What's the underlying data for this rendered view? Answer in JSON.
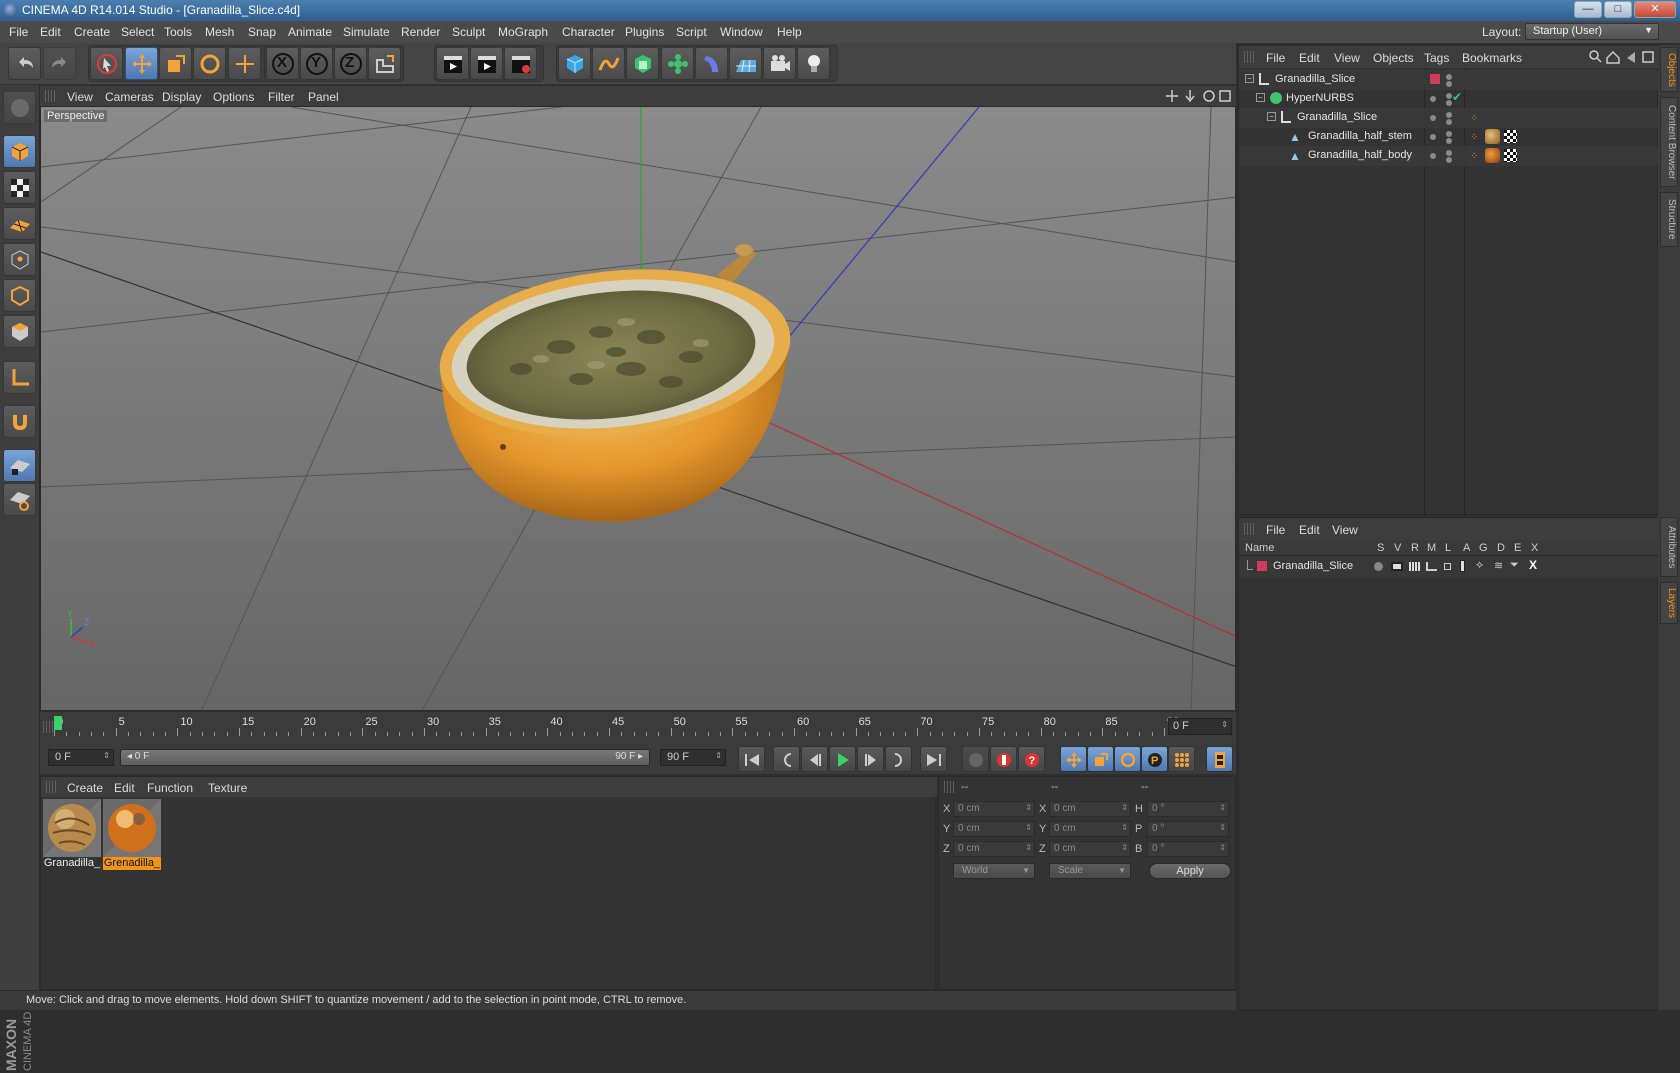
{
  "window": {
    "title": "CINEMA 4D R14.014 Studio - [Granadilla_Slice.c4d]",
    "min": "—",
    "max": "□",
    "close": "✕"
  },
  "menubar": {
    "items": [
      "File",
      "Edit",
      "Create",
      "Select",
      "Tools",
      "Mesh",
      "Snap",
      "Animate",
      "Simulate",
      "Render",
      "Sculpt",
      "MoGraph",
      "Character",
      "Plugins",
      "Script",
      "Window",
      "Help"
    ],
    "layout_label": "Layout:",
    "layout_value": "Startup (User)"
  },
  "toolbar": {
    "axis_x": "X",
    "axis_y": "Y",
    "axis_z": "Z"
  },
  "viewport": {
    "menu": [
      "View",
      "Cameras",
      "Display",
      "Options",
      "Filter",
      "Panel"
    ],
    "label": "Perspective",
    "axis_y": "Y",
    "axis_z": "Z",
    "axis_x": "X"
  },
  "timeline": {
    "labels": [
      "0",
      "5",
      "10",
      "15",
      "20",
      "25",
      "30",
      "35",
      "40",
      "45",
      "50",
      "55",
      "60",
      "65",
      "70",
      "75",
      "80",
      "85",
      "90"
    ],
    "current_frame": "0 F"
  },
  "playbar": {
    "start": "0 F",
    "range_start": "◂ 0 F",
    "range_end": "90 F ▸",
    "end": "90 F"
  },
  "materials": {
    "menu": [
      "Create",
      "Edit",
      "Function",
      "Texture"
    ],
    "items": [
      {
        "name": "Granadilla_"
      },
      {
        "name": "Grenadilla_"
      }
    ]
  },
  "coords": {
    "head1": "--",
    "head2": "--",
    "head3": "--",
    "rows": [
      {
        "l1": "X",
        "v1": "0 cm",
        "l2": "X",
        "v2": "0 cm",
        "l3": "H",
        "v3": "0 °"
      },
      {
        "l1": "Y",
        "v1": "0 cm",
        "l2": "Y",
        "v2": "0 cm",
        "l3": "P",
        "v3": "0 °"
      },
      {
        "l1": "Z",
        "v1": "0 cm",
        "l2": "Z",
        "v2": "0 cm",
        "l3": "B",
        "v3": "0 °"
      }
    ],
    "world": "World",
    "scale": "Scale",
    "apply": "Apply"
  },
  "status": "Move: Click and drag to move elements. Hold down SHIFT to quantize movement / add to the selection in point mode, CTRL to remove.",
  "objects": {
    "menu": [
      "File",
      "Edit",
      "View",
      "Objects",
      "Tags",
      "Bookmarks"
    ],
    "tree": [
      "Granadilla_Slice",
      "HyperNURBS",
      "Granadilla_Slice",
      "Granadilla_half_stem",
      "Granadilla_half_body"
    ]
  },
  "layers": {
    "menu": [
      "File",
      "Edit",
      "View"
    ],
    "columns": [
      "Name",
      "S",
      "V",
      "R",
      "M",
      "L",
      "A",
      "G",
      "D",
      "E",
      "X"
    ],
    "row": "Granadilla_Slice",
    "x": "X"
  },
  "side_tabs": [
    "Objects",
    "Content Browser",
    "Structure",
    "Attributes",
    "Layers"
  ],
  "brand": {
    "maxon": "MAXON",
    "cinema": "CINEMA 4D"
  },
  "colors": {
    "accent": "#f29418",
    "layer": "#d23c5a",
    "axis_x": "#c83a3a",
    "axis_y": "#3cbc3c",
    "axis_z": "#3a3ac8"
  }
}
